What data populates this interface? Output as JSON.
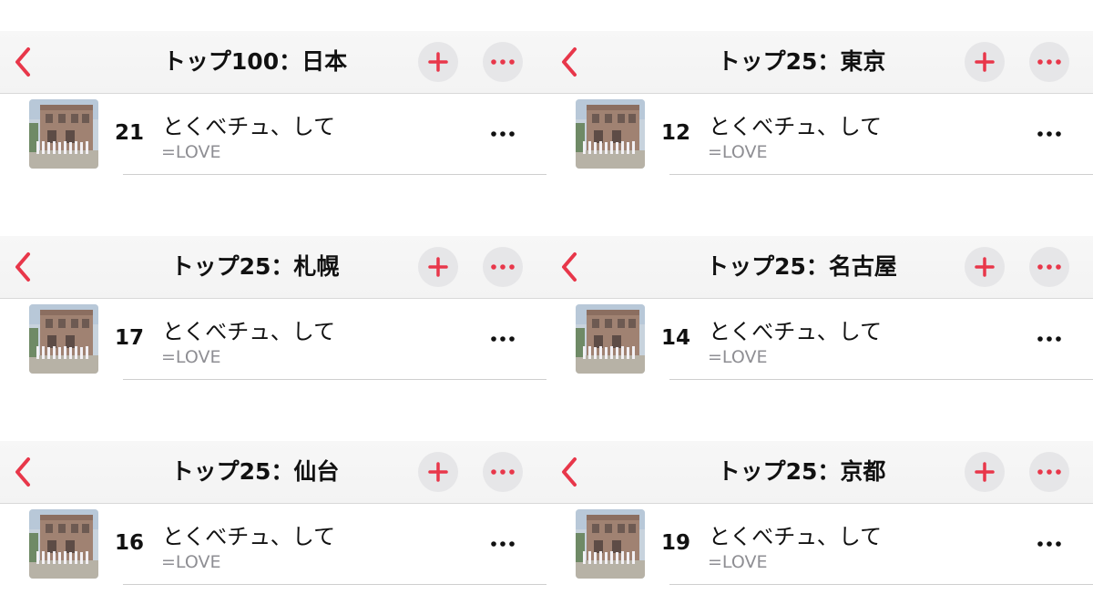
{
  "colors": {
    "accent": "#e8374a",
    "title": "#111111",
    "secondary": "#8e8e93",
    "button_bg": "#e6e6e8"
  },
  "panels": [
    {
      "nav_title": "トップ100：日本",
      "back_icon": "chevron-left-icon",
      "add_icon": "plus-icon",
      "more_icon": "ellipsis-icon",
      "song": {
        "rank": "21",
        "title": "とくべチュ、して",
        "artist": "=LOVE",
        "artwork_icon": "album-artwork"
      }
    },
    {
      "nav_title": "トップ25：東京",
      "back_icon": "chevron-left-icon",
      "add_icon": "plus-icon",
      "more_icon": "ellipsis-icon",
      "song": {
        "rank": "12",
        "title": "とくべチュ、して",
        "artist": "=LOVE",
        "artwork_icon": "album-artwork"
      }
    },
    {
      "nav_title": "トップ25：札幌",
      "back_icon": "chevron-left-icon",
      "add_icon": "plus-icon",
      "more_icon": "ellipsis-icon",
      "song": {
        "rank": "17",
        "title": "とくべチュ、して",
        "artist": "=LOVE",
        "artwork_icon": "album-artwork"
      }
    },
    {
      "nav_title": "トップ25：名古屋",
      "back_icon": "chevron-left-icon",
      "add_icon": "plus-icon",
      "more_icon": "ellipsis-icon",
      "song": {
        "rank": "14",
        "title": "とくべチュ、して",
        "artist": "=LOVE",
        "artwork_icon": "album-artwork"
      }
    },
    {
      "nav_title": "トップ25：仙台",
      "back_icon": "chevron-left-icon",
      "add_icon": "plus-icon",
      "more_icon": "ellipsis-icon",
      "song": {
        "rank": "16",
        "title": "とくべチュ、して",
        "artist": "=LOVE",
        "artwork_icon": "album-artwork"
      }
    },
    {
      "nav_title": "トップ25：京都",
      "back_icon": "chevron-left-icon",
      "add_icon": "plus-icon",
      "more_icon": "ellipsis-icon",
      "song": {
        "rank": "19",
        "title": "とくべチュ、して",
        "artist": "=LOVE",
        "artwork_icon": "album-artwork"
      }
    }
  ]
}
